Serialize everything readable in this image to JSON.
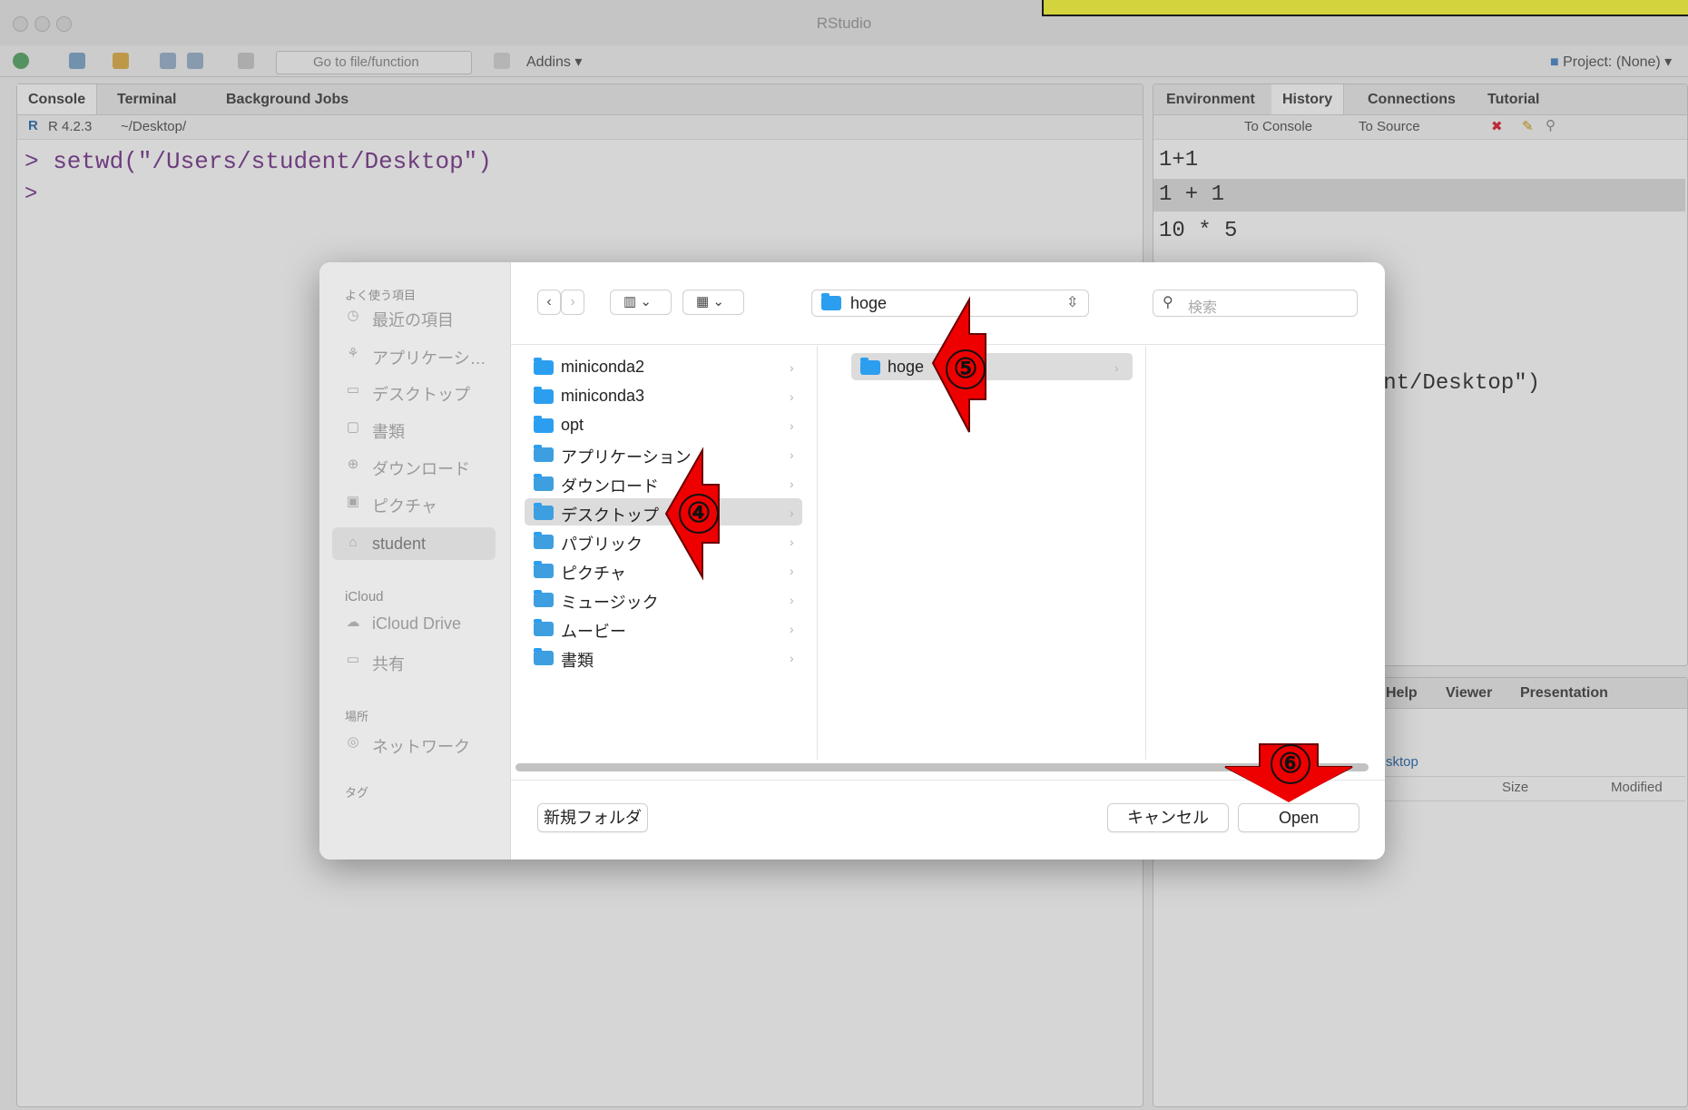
{
  "window": {
    "title": "RStudio"
  },
  "toolbar": {
    "goto_placeholder": "Go to file/function",
    "addins_label": "Addins",
    "project_label": "Project: (None)"
  },
  "left_pane": {
    "tabs": [
      "Console",
      "Terminal",
      "Background Jobs"
    ],
    "r_version": "R 4.2.3",
    "working_dir": "~/Desktop/",
    "console_lines": [
      "> setwd(\"/Users/student/Desktop\")",
      ">"
    ]
  },
  "right_top": {
    "tabs": [
      "Environment",
      "History",
      "Connections",
      "Tutorial"
    ],
    "to_console": "To Console",
    "to_source": "To Source",
    "history_lines": [
      "1+1",
      "1 + 1",
      "10 * 5"
    ],
    "history_tail": "udent/Desktop\")"
  },
  "right_bottom": {
    "tabs": [
      "Help",
      "Viewer",
      "Presentation"
    ],
    "path_fragment": "sktop",
    "col_size": "Size",
    "col_modified": "Modified"
  },
  "dialog": {
    "sidebar": {
      "favorites_header": "よく使う項目",
      "favorites": [
        {
          "label": "最近の項目",
          "icon": "clock-icon"
        },
        {
          "label": "アプリケーシ…",
          "icon": "apps-icon"
        },
        {
          "label": "デスクトップ",
          "icon": "desktop-icon"
        },
        {
          "label": "書類",
          "icon": "document-icon"
        },
        {
          "label": "ダウンロード",
          "icon": "download-icon"
        },
        {
          "label": "ピクチャ",
          "icon": "picture-icon"
        },
        {
          "label": "student",
          "icon": "home-icon"
        }
      ],
      "icloud_header": "iCloud",
      "icloud": [
        {
          "label": "iCloud Drive",
          "icon": "cloud-icon"
        },
        {
          "label": "共有",
          "icon": "shared-folder-icon"
        }
      ],
      "locations_header": "場所",
      "locations": [
        {
          "label": "ネットワーク",
          "icon": "network-icon"
        }
      ],
      "tags_header": "タグ"
    },
    "current_folder": "hoge",
    "search_placeholder": "検索",
    "column1": [
      "miniconda2",
      "miniconda3",
      "opt",
      "アプリケーション",
      "ダウンロード",
      "デスクトップ",
      "パブリック",
      "ピクチャ",
      "ミュージック",
      "ムービー",
      "書類"
    ],
    "column1_selected": "デスクトップ",
    "column2": [
      "hoge"
    ],
    "new_folder_label": "新規フォルダ",
    "cancel_label": "キャンセル",
    "open_label": "Open"
  },
  "annotations": {
    "step4": "④",
    "step5": "⑤",
    "step6": "⑥",
    "arrow_color": "#ee0000"
  }
}
